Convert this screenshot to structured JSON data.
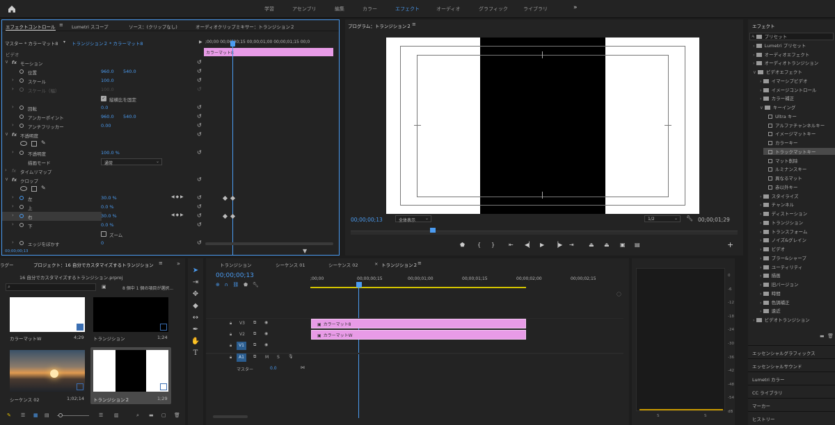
{
  "workspaces": [
    "学習",
    "アセンブリ",
    "編集",
    "カラー",
    "エフェクト",
    "オーディオ",
    "グラフィック",
    "ライブラリ"
  ],
  "active_workspace": "エフェクト",
  "effect_controls": {
    "tabs": [
      "エフェクトコントロール",
      "Lumetri スコープ",
      "ソース：(クリップなし)",
      "オーディオクリップミキサー：トランジション２"
    ],
    "master": "マスター * カラーマット8",
    "sequence_clip": "トランジション２ * カラーマット8",
    "mini_ruler": ";00;00  00;00;00;15  00;00;01;00  00;00;01;15  00;0",
    "clip_label": "カラーマット8",
    "video_header": "ビデオ",
    "motion": "モーション",
    "position": "位置",
    "position_x": "960.0",
    "position_y": "540.0",
    "scale": "スケール",
    "scale_value": "100.0",
    "scale_w": "スケール（幅）",
    "scale_w_value": "100.0",
    "keep_ratio": "縦横比を固定",
    "rotation": "回転",
    "rotation_value": "0.0",
    "anchor": "アンカーポイント",
    "anchor_x": "960.0",
    "anchor_y": "540.0",
    "antiflicker": "アンチフリッカー",
    "antiflicker_value": "0.00",
    "opacity": "不透明度",
    "opacity_label": "不透明度",
    "opacity_value": "100.0 %",
    "blend_mode": "描画モード",
    "blend_value": "通常",
    "time_remap": "タイムリマップ",
    "crop": "クロップ",
    "crop_left": "左",
    "crop_left_value": "30.0 %",
    "crop_top": "上",
    "crop_top_value": "0.0 %",
    "crop_right": "右",
    "crop_right_value": "30.0 %",
    "crop_bottom": "下",
    "crop_bottom_value": "0.0 %",
    "zoom": "ズーム",
    "edge_feather": "エッジをぼかす",
    "edge_value": "0",
    "timecode": "00;00;00;13"
  },
  "program": {
    "title": "プログラム：トランジション２",
    "timecode": "00;00;00;13",
    "fit": "全体表示",
    "resolution": "1/2",
    "duration": "00;00;01;29"
  },
  "project": {
    "tag_tab": "ラグー",
    "title": "プロジェクト：16 自分でカスタマイズするトランジション",
    "file": "16 自分でカスタマイズするトランジション.prproj",
    "selection": "8 個中 1 個の項目が選択...",
    "items": [
      {
        "name": "カラーマットW",
        "duration": "4;29"
      },
      {
        "name": "トランジション",
        "duration": "1;24"
      },
      {
        "name": "シーケンス 02",
        "duration": "1;02;14"
      },
      {
        "name": "トランジション２",
        "duration": "1;29"
      }
    ]
  },
  "timeline": {
    "tabs": [
      "トランジション",
      "シーケンス 01",
      "シーケンス 02",
      "トランジション２"
    ],
    "timecode": "00;00;00;13",
    "ruler": [
      ";00;00",
      "00;00;00;15",
      "00;00;01;00",
      "00;00;01;15",
      "00;00;02;00",
      "00;00;02;15"
    ],
    "tracks": [
      "V3",
      "V2",
      "V1",
      "A1"
    ],
    "master": "マスター",
    "master_value": "0.0",
    "clip_v3": "カラーマット8",
    "clip_v2": "カラーマットW"
  },
  "effects_panel": {
    "title": "エフェクト",
    "items": [
      "プリセット",
      "Lumetri プリセット",
      "オーディオエフェクト",
      "オーディオトランジション",
      "ビデオエフェクト",
      "イマーシブビデオ",
      "イメージコントロール",
      "カラー補正",
      "キーイング",
      "Ultra キー",
      "アルファチャンネルキー",
      "イメージマットキー",
      "カラーキー",
      "トラックマットキー",
      "マット削除",
      "ルミナンスキー",
      "異なるマット",
      "赤以外キー",
      "スタイライズ",
      "チャンネル",
      "ディストーション",
      "トランジション",
      "トランスフォーム",
      "ノイズ&グレイン",
      "ビデオ",
      "ブラー&シャープ",
      "ユーティリティ",
      "描画",
      "旧バージョン",
      "時間",
      "色調補正",
      "遠近",
      "ビデオトランジション"
    ],
    "selected": "トラックマットキー",
    "sections": [
      "エッセンシャルグラフィックス",
      "エッセンシャルサウンド",
      "Lumetri カラー",
      "CC ライブラリ",
      "マーカー",
      "ヒストリー"
    ]
  },
  "audio_meter": {
    "scale": [
      "0",
      "-6",
      "-12",
      "-18",
      "-24",
      "-30",
      "-36",
      "-42",
      "-48",
      "-54",
      "dB"
    ],
    "channels": [
      "S",
      "S"
    ]
  }
}
